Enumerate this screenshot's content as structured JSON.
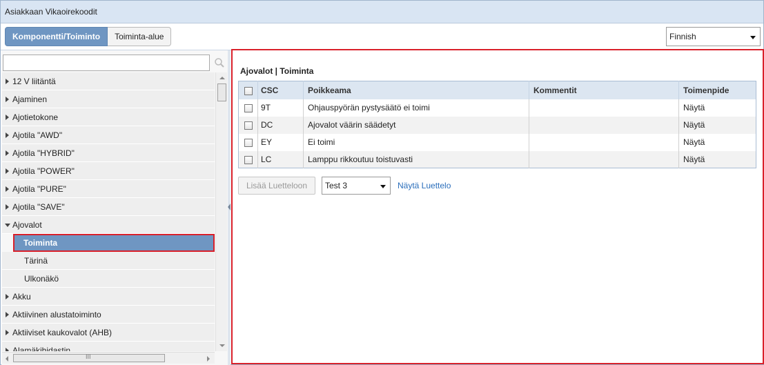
{
  "window": {
    "title": "Asiakkaan Vikaoirekoodit"
  },
  "tabs": [
    {
      "label": "Komponentti/Toiminto",
      "active": true
    },
    {
      "label": "Toiminta-alue",
      "active": false
    }
  ],
  "language": {
    "selected": "Finnish"
  },
  "tree": {
    "search_value": "",
    "items": [
      {
        "label": "12 V liitäntä",
        "state": "collapsed"
      },
      {
        "label": "Ajaminen",
        "state": "collapsed"
      },
      {
        "label": "Ajotietokone",
        "state": "collapsed"
      },
      {
        "label": "Ajotila \"AWD\"",
        "state": "collapsed"
      },
      {
        "label": "Ajotila \"HYBRID\"",
        "state": "collapsed"
      },
      {
        "label": "Ajotila \"POWER\"",
        "state": "collapsed"
      },
      {
        "label": "Ajotila \"PURE\"",
        "state": "collapsed"
      },
      {
        "label": "Ajotila \"SAVE\"",
        "state": "collapsed"
      },
      {
        "label": "Ajovalot",
        "state": "expanded"
      },
      {
        "label": "Toiminta",
        "state": "selected"
      },
      {
        "label": "Tärinä",
        "state": "child"
      },
      {
        "label": "Ulkonäkö",
        "state": "child"
      },
      {
        "label": "Akku",
        "state": "collapsed"
      },
      {
        "label": "Aktiivinen alustatoiminto",
        "state": "collapsed"
      },
      {
        "label": "Aktiiviset kaukovalot (AHB)",
        "state": "collapsed"
      },
      {
        "label": "Alamäkihidastin",
        "state": "collapsed"
      }
    ],
    "hscroll_label": "III"
  },
  "main": {
    "title": "Ajovalot | Toiminta",
    "columns": [
      "CSC",
      "Poikkeama",
      "Kommentit",
      "Toimenpide"
    ],
    "rows": [
      {
        "csc": "9T",
        "poikkeama": "Ohjauspyörän pystysäätö ei toimi",
        "kommentit": "",
        "toimenpide": "Näytä"
      },
      {
        "csc": "DC",
        "poikkeama": "Ajovalot väärin säädetyt",
        "kommentit": "",
        "toimenpide": "Näytä"
      },
      {
        "csc": "EY",
        "poikkeama": "Ei toimi",
        "kommentit": "",
        "toimenpide": "Näytä"
      },
      {
        "csc": "LC",
        "poikkeama": "Lamppu rikkoutuu toistuvasti",
        "kommentit": "",
        "toimenpide": "Näytä"
      }
    ],
    "add_button": "Lisää Luetteloon",
    "list_select": "Test 3",
    "show_list_link": "Näytä Luettelo"
  },
  "colors": {
    "accent": "#6f96c2",
    "highlight": "#d9202a",
    "link": "#2a6ebb"
  }
}
